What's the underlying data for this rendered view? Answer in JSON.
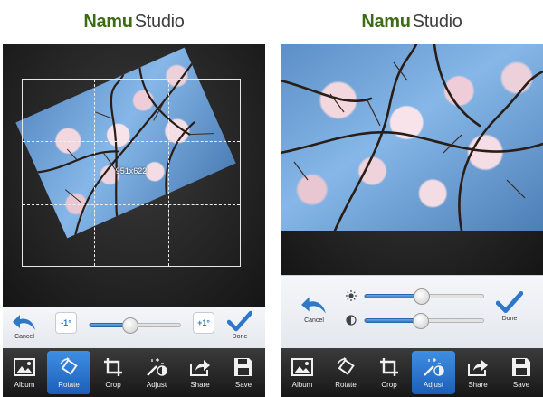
{
  "screens": [
    {
      "brand": {
        "bold": "Namu",
        "light": "Studio"
      },
      "dimensions_label": "951x622",
      "controls": {
        "cancel_label": "Cancel",
        "done_label": "Done",
        "rotate_left_label": "-1°",
        "rotate_right_label": "+1°",
        "rotation_slider": {
          "value": 0.45
        }
      },
      "toolbar": [
        {
          "label": "Album",
          "icon": "image-icon",
          "active": false
        },
        {
          "label": "Rotate",
          "icon": "rotate-icon",
          "active": true
        },
        {
          "label": "Crop",
          "icon": "crop-icon",
          "active": false
        },
        {
          "label": "Adjust",
          "icon": "magic-wand-icon",
          "active": false
        },
        {
          "label": "Share",
          "icon": "share-icon",
          "active": false
        },
        {
          "label": "Save",
          "icon": "save-icon",
          "active": false
        }
      ]
    },
    {
      "brand": {
        "bold": "Namu",
        "light": "Studio"
      },
      "controls": {
        "cancel_label": "Cancel",
        "done_label": "Done",
        "brightness_slider": {
          "value": 0.48
        },
        "contrast_slider": {
          "value": 0.47
        }
      },
      "toolbar": [
        {
          "label": "Album",
          "icon": "image-icon",
          "active": false
        },
        {
          "label": "Rotate",
          "icon": "rotate-icon",
          "active": false
        },
        {
          "label": "Crop",
          "icon": "crop-icon",
          "active": false
        },
        {
          "label": "Adjust",
          "icon": "magic-wand-icon",
          "active": true
        },
        {
          "label": "Share",
          "icon": "share-icon",
          "active": false
        },
        {
          "label": "Save",
          "icon": "save-icon",
          "active": false
        }
      ]
    }
  ],
  "colors": {
    "brand_green": "#3d6d12",
    "accent_blue": "#2f77c9",
    "toolbar_dark": "#1e1e1e"
  }
}
